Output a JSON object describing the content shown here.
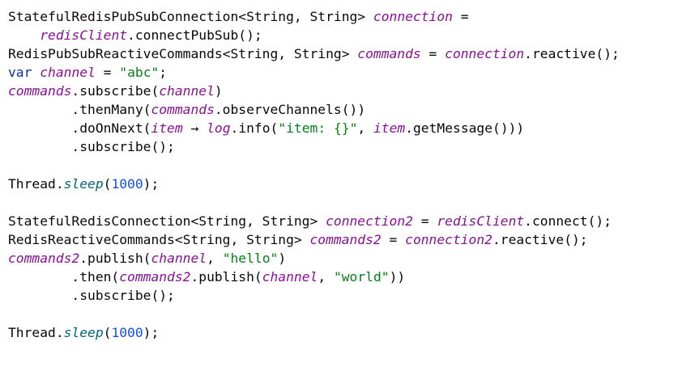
{
  "editor": {
    "lines": [
      {
        "id": "l1",
        "tokens": [
          {
            "c": "t",
            "v": "StatefulRedisPubSubConnection<String, String> "
          },
          {
            "c": "p",
            "v": "connection"
          },
          {
            "c": "t",
            "v": " ="
          }
        ]
      },
      {
        "id": "l2",
        "tokens": [
          {
            "c": "t",
            "v": "    "
          },
          {
            "c": "p",
            "v": "redisClient"
          },
          {
            "c": "t",
            "v": ".connectPubSub();"
          }
        ]
      },
      {
        "id": "l3",
        "tokens": [
          {
            "c": "t",
            "v": "RedisPubSubReactiveCommands<String, String> "
          },
          {
            "c": "p",
            "v": "commands"
          },
          {
            "c": "t",
            "v": " = "
          },
          {
            "c": "p",
            "v": "connection"
          },
          {
            "c": "t",
            "v": ".reactive();"
          }
        ]
      },
      {
        "id": "l4",
        "tokens": [
          {
            "c": "k",
            "v": "var"
          },
          {
            "c": "t",
            "v": " "
          },
          {
            "c": "p",
            "v": "channel"
          },
          {
            "c": "t",
            "v": " = "
          },
          {
            "c": "s",
            "v": "\"abc\""
          },
          {
            "c": "t",
            "v": ";"
          }
        ]
      },
      {
        "id": "l5",
        "tokens": [
          {
            "c": "p",
            "v": "commands"
          },
          {
            "c": "t",
            "v": ".subscribe("
          },
          {
            "c": "p",
            "v": "channel"
          },
          {
            "c": "t",
            "v": ")"
          }
        ]
      },
      {
        "id": "l6",
        "tokens": [
          {
            "c": "t",
            "v": "        .thenMany("
          },
          {
            "c": "p",
            "v": "commands"
          },
          {
            "c": "t",
            "v": ".observeChannels())"
          }
        ]
      },
      {
        "id": "l7",
        "tokens": [
          {
            "c": "t",
            "v": "        .doOnNext("
          },
          {
            "c": "p",
            "v": "item"
          },
          {
            "c": "t",
            "v": " → "
          },
          {
            "c": "p",
            "v": "log"
          },
          {
            "c": "t",
            "v": ".info("
          },
          {
            "c": "s",
            "v": "\"item: {}\""
          },
          {
            "c": "t",
            "v": ", "
          },
          {
            "c": "p",
            "v": "item"
          },
          {
            "c": "t",
            "v": ".getMessage()))"
          }
        ]
      },
      {
        "id": "l8",
        "tokens": [
          {
            "c": "t",
            "v": "        .subscribe();"
          }
        ]
      },
      {
        "id": "l9",
        "tokens": []
      },
      {
        "id": "l10",
        "tokens": [
          {
            "c": "t",
            "v": "Thread."
          },
          {
            "c": "m",
            "v": "sleep"
          },
          {
            "c": "t",
            "v": "("
          },
          {
            "c": "n",
            "v": "1000"
          },
          {
            "c": "t",
            "v": ");"
          }
        ]
      },
      {
        "id": "l11",
        "tokens": []
      },
      {
        "id": "l12",
        "tokens": [
          {
            "c": "t",
            "v": "StatefulRedisConnection<String, String> "
          },
          {
            "c": "p",
            "v": "connection2"
          },
          {
            "c": "t",
            "v": " = "
          },
          {
            "c": "p",
            "v": "redisClient"
          },
          {
            "c": "t",
            "v": ".connect();"
          }
        ]
      },
      {
        "id": "l13",
        "tokens": [
          {
            "c": "t",
            "v": "RedisReactiveCommands<String, String> "
          },
          {
            "c": "p",
            "v": "commands2"
          },
          {
            "c": "t",
            "v": " = "
          },
          {
            "c": "p",
            "v": "connection2"
          },
          {
            "c": "t",
            "v": ".reactive();"
          }
        ]
      },
      {
        "id": "l14",
        "tokens": [
          {
            "c": "p",
            "v": "commands2"
          },
          {
            "c": "t",
            "v": ".publish("
          },
          {
            "c": "p",
            "v": "channel"
          },
          {
            "c": "t",
            "v": ", "
          },
          {
            "c": "s",
            "v": "\"hello\""
          },
          {
            "c": "t",
            "v": ")"
          }
        ]
      },
      {
        "id": "l15",
        "tokens": [
          {
            "c": "t",
            "v": "        .then("
          },
          {
            "c": "p",
            "v": "commands2"
          },
          {
            "c": "t",
            "v": ".publish("
          },
          {
            "c": "p",
            "v": "channel"
          },
          {
            "c": "t",
            "v": ", "
          },
          {
            "c": "s",
            "v": "\"world\""
          },
          {
            "c": "t",
            "v": "))"
          }
        ]
      },
      {
        "id": "l16",
        "tokens": [
          {
            "c": "t",
            "v": "        .subscribe();"
          }
        ]
      },
      {
        "id": "l17",
        "tokens": []
      },
      {
        "id": "l18",
        "tokens": [
          {
            "c": "t",
            "v": "Thread."
          },
          {
            "c": "m",
            "v": "sleep"
          },
          {
            "c": "t",
            "v": "("
          },
          {
            "c": "n",
            "v": "1000"
          },
          {
            "c": "t",
            "v": ");"
          }
        ]
      }
    ]
  },
  "colors": {
    "background": "#ffffff",
    "plain": "#080808",
    "field_italic": "#871094",
    "string": "#067d17",
    "keyword": "#0033b3",
    "number": "#1750eb",
    "static_method": "#00627a"
  }
}
